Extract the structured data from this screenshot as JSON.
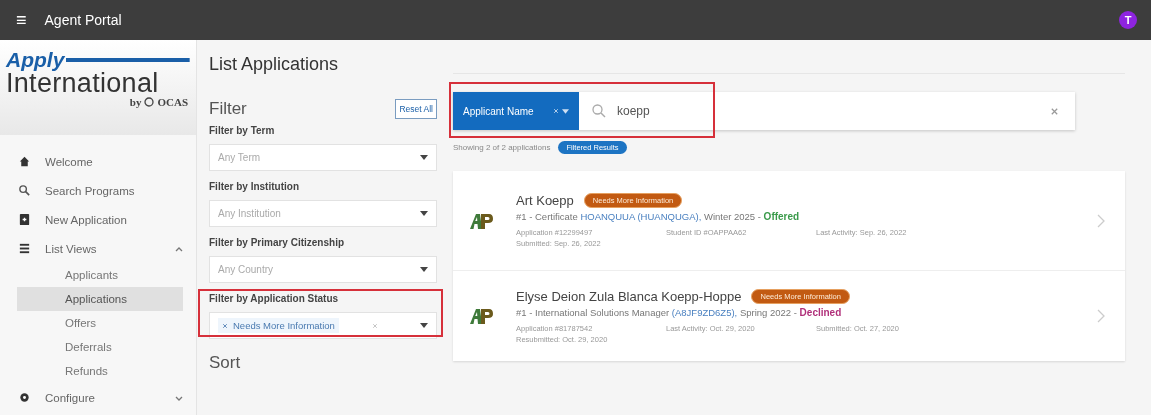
{
  "top_bar": {
    "menu_glyph": "≡",
    "title": "Agent Portal",
    "avatar": "T"
  },
  "logo": {
    "apply": "Apply",
    "international": "International",
    "by": "by",
    "ocas": "OCAS"
  },
  "sidebar": {
    "items": [
      {
        "label": "Welcome",
        "selected": false
      },
      {
        "label": "Search Programs",
        "selected": false
      },
      {
        "label": "New Application",
        "selected": false
      },
      {
        "label": "List Views",
        "selected": false,
        "expanded": true,
        "children": [
          {
            "label": "Applicants",
            "selected": false
          },
          {
            "label": "Applications",
            "selected": true
          },
          {
            "label": "Offers",
            "selected": false
          },
          {
            "label": "Deferrals",
            "selected": false
          },
          {
            "label": "Refunds",
            "selected": false
          }
        ]
      },
      {
        "label": "Configure",
        "selected": false,
        "expanded": false
      }
    ]
  },
  "page_title": "List Applications",
  "filter": {
    "heading": "Filter",
    "reset": "Reset All",
    "fields": [
      {
        "label": "Filter by Term",
        "placeholder": "Any Term",
        "highlighted": false
      },
      {
        "label": "Filter by Institution",
        "placeholder": "Any Institution",
        "highlighted": false
      },
      {
        "label": "Filter by Primary Citizenship",
        "placeholder": "Any Country",
        "highlighted": false
      },
      {
        "label": "Filter by Application Status",
        "chips": [
          "Needs More Information"
        ],
        "highlighted": true
      }
    ]
  },
  "sort": {
    "heading": "Sort"
  },
  "search": {
    "field": "Applicant Name",
    "value": "koepp",
    "highlighted": true
  },
  "results": {
    "summary": "Showing 2 of 2 applications",
    "tag": "Filtered Results"
  },
  "applications": [
    {
      "name": "Art Koepp",
      "badge": "Needs More Information",
      "number": "#1 - Certificate",
      "program": "HOANQUUA (HUANQUGA),",
      "term": "Winter 2025 -",
      "status": "Offered",
      "color": "#3a9a4a",
      "meta": [
        "Application #12299497",
        "Student ID #OAPPAA62",
        "Last Activity: Sep. 26, 2022",
        "Submitted: Sep. 26, 2022"
      ]
    },
    {
      "name": "Elyse Deion Zula Blanca Koepp-Hoppe",
      "badge": "Needs More Information",
      "number": "#1 - International Solutions Manager",
      "program": "(A8JF9ZD6Z5),",
      "term": "Spring 2022 -",
      "status": "Declined",
      "color": "#b0307a",
      "meta": [
        "Application #81787542",
        "Last Activity: Oct. 29, 2020",
        "Submitted: Oct. 27, 2020",
        "Resubmitted: Oct. 29, 2020"
      ]
    }
  ]
}
